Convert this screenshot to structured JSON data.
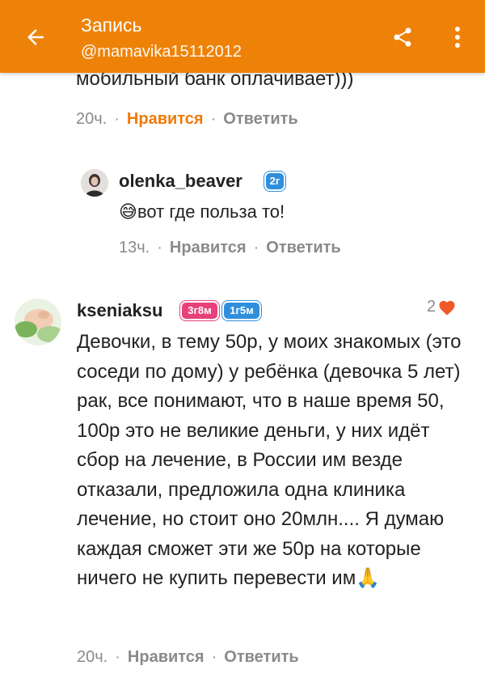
{
  "header": {
    "title": "Запись",
    "subtitle": "@mamavika15112012",
    "back_icon": "arrow-back-icon",
    "share_icon": "share-icon",
    "more_icon": "more-vert-icon",
    "color": "#ee8208"
  },
  "comments": [
    {
      "text_fragment": "мобильный банк оплачивает)))",
      "time": "20ч.",
      "like_label": "Нравится",
      "reply_label": "Ответить",
      "liked": true
    },
    {
      "author": "olenka_beaver",
      "badges": [
        "2г"
      ],
      "text": "вот где польза то!",
      "emoji": "😅",
      "time": "13ч.",
      "like_label": "Нравится",
      "reply_label": "Ответить",
      "liked": false
    },
    {
      "author": "kseniaksu",
      "badges": [
        "3г8м",
        "1г5м"
      ],
      "like_count": "2",
      "text": "Девочки, в тему 50р, у моих знакомых (это соседи по дому) у ребёнка (девочка 5 лет) рак, все понимают, что в наше время 50, 100р это не великие деньги, у них идёт сбор на лечение, в России им везде отказали, предложила одна клиника лечение, но стоит оно 20млн.... Я думаю каждая сможет эти же 50р на которые ничего не купить перевести им",
      "emoji": "🙏",
      "time": "20ч.",
      "like_label": "Нравится",
      "reply_label": "Ответить",
      "liked": false
    }
  ],
  "separator": "·",
  "accent_color": "#ee7a0a",
  "heart_color": "#f05a28"
}
